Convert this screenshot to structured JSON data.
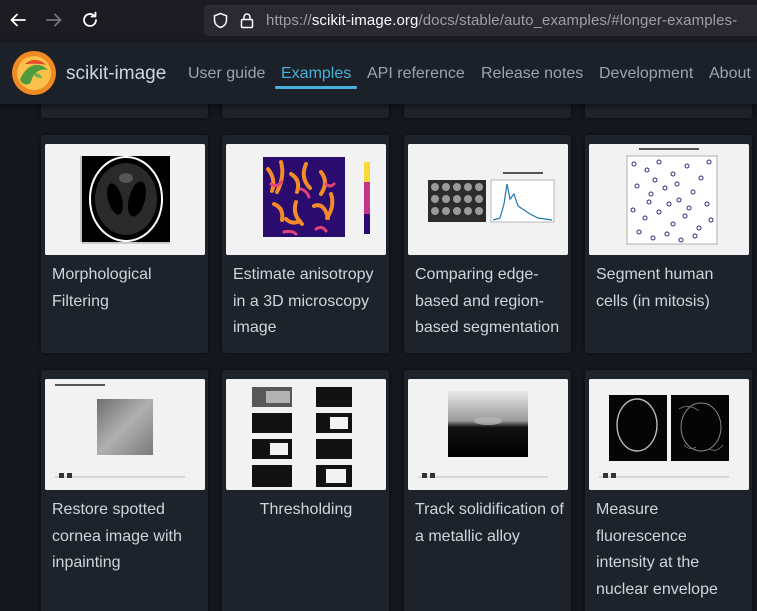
{
  "browser": {
    "url_prefix": "https://",
    "url_host": "scikit-image.org",
    "url_path": "/docs/stable/auto_examples/#longer-examples-"
  },
  "header": {
    "site_name": "scikit-image",
    "nav": [
      "User guide",
      "Examples",
      "API reference",
      "Release notes",
      "Development",
      "About"
    ],
    "active": "Examples"
  },
  "gallery": {
    "row1": [
      {
        "title": "Morphological Filtering"
      },
      {
        "title": "Estimate anisotropy in a 3D microscopy image"
      },
      {
        "title": "Comparing edge-based and region-based segmentation"
      },
      {
        "title": "Segment human cells (in mitosis)"
      }
    ],
    "row2": [
      {
        "title": "Restore spotted cornea image with inpainting"
      },
      {
        "title": "Thresholding"
      },
      {
        "title": "Track solidification of a metallic alloy"
      },
      {
        "title": "Measure fluorescence intensity at the nuclear envelope"
      }
    ]
  }
}
